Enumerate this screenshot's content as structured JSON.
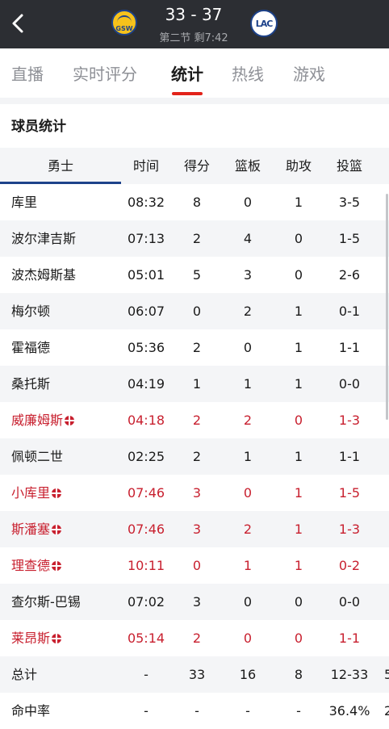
{
  "header": {
    "back_icon": "chevron-left-icon",
    "home_logo_text": "GSW",
    "away_logo_text": "LAC",
    "score": "33 - 37",
    "period": "第二节 剩7:42"
  },
  "tabs": [
    "直播",
    "实时评分",
    "统计",
    "热线",
    "游戏"
  ],
  "active_tab": "统计",
  "section_title": "球员统计",
  "table": {
    "team_header": "勇士",
    "columns": [
      "时间",
      "得分",
      "篮板",
      "助攻",
      "投篮"
    ],
    "rows": [
      {
        "name": "库里",
        "time": "08:32",
        "pts": "8",
        "reb": "0",
        "ast": "1",
        "fg": "3-5",
        "starter": false
      },
      {
        "name": "波尔津吉斯",
        "time": "07:13",
        "pts": "2",
        "reb": "4",
        "ast": "0",
        "fg": "1-5",
        "starter": false
      },
      {
        "name": "波杰姆斯基",
        "time": "05:01",
        "pts": "5",
        "reb": "3",
        "ast": "0",
        "fg": "2-6",
        "starter": false
      },
      {
        "name": "梅尔顿",
        "time": "06:07",
        "pts": "0",
        "reb": "2",
        "ast": "1",
        "fg": "0-1",
        "starter": false
      },
      {
        "name": "霍福德",
        "time": "05:36",
        "pts": "2",
        "reb": "0",
        "ast": "1",
        "fg": "1-1",
        "starter": false
      },
      {
        "name": "桑托斯",
        "time": "04:19",
        "pts": "1",
        "reb": "1",
        "ast": "1",
        "fg": "0-0",
        "starter": false
      },
      {
        "name": "威廉姆斯",
        "time": "04:18",
        "pts": "2",
        "reb": "2",
        "ast": "0",
        "fg": "1-3",
        "starter": true
      },
      {
        "name": "佩顿二世",
        "time": "02:25",
        "pts": "2",
        "reb": "1",
        "ast": "1",
        "fg": "1-1",
        "starter": false
      },
      {
        "name": "小库里",
        "time": "07:46",
        "pts": "3",
        "reb": "0",
        "ast": "1",
        "fg": "1-5",
        "starter": true
      },
      {
        "name": "斯潘塞",
        "time": "07:46",
        "pts": "3",
        "reb": "2",
        "ast": "1",
        "fg": "1-3",
        "starter": true
      },
      {
        "name": "理查德",
        "time": "10:11",
        "pts": "0",
        "reb": "1",
        "ast": "1",
        "fg": "0-2",
        "starter": true
      },
      {
        "name": "查尔斯-巴锡",
        "time": "07:02",
        "pts": "3",
        "reb": "0",
        "ast": "0",
        "fg": "0-0",
        "starter": false
      },
      {
        "name": "莱昂斯",
        "time": "05:14",
        "pts": "2",
        "reb": "0",
        "ast": "0",
        "fg": "1-1",
        "starter": true
      }
    ],
    "total": {
      "name": "总计",
      "time": "-",
      "pts": "33",
      "reb": "16",
      "ast": "8",
      "fg": "12-33",
      "extra": "5"
    },
    "rate": {
      "name": "命中率",
      "time": "-",
      "pts": "-",
      "reb": "-",
      "ast": "-",
      "fg": "36.4%",
      "extra": "2"
    }
  },
  "colors": {
    "header_bg": "#2c2e33",
    "accent_red": "#e2231a",
    "starter_red": "#c8202f",
    "team_blue": "#1d428a"
  }
}
